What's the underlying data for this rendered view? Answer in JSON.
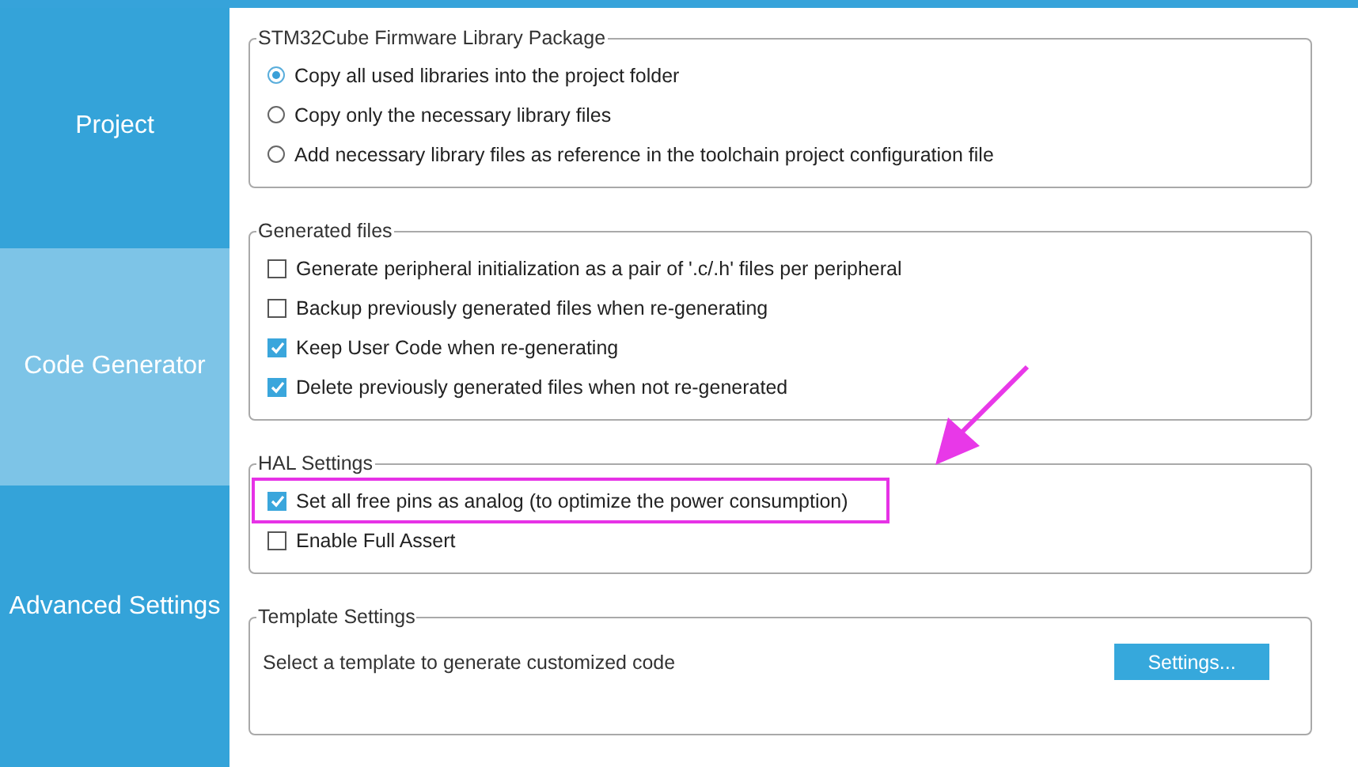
{
  "sidebar": {
    "items": [
      {
        "label": "Project",
        "selected": false
      },
      {
        "label": "Code Generator",
        "selected": true
      },
      {
        "label": "Advanced Settings",
        "selected": false
      }
    ]
  },
  "groups": [
    {
      "title": "STM32Cube Firmware Library Package",
      "options": [
        {
          "kind": "radio",
          "label": "Copy all used libraries into the project folder",
          "checked": true,
          "highlighted": false
        },
        {
          "kind": "radio",
          "label": "Copy only the necessary library files",
          "checked": false,
          "highlighted": false
        },
        {
          "kind": "radio",
          "label": "Add necessary library files as reference in the toolchain project configuration file",
          "checked": false,
          "highlighted": false
        }
      ]
    },
    {
      "title": "Generated files",
      "options": [
        {
          "kind": "checkbox",
          "label": "Generate peripheral initialization as a pair of '.c/.h' files per peripheral",
          "checked": false,
          "highlighted": false
        },
        {
          "kind": "checkbox",
          "label": "Backup previously generated files when re-generating",
          "checked": false,
          "highlighted": false
        },
        {
          "kind": "checkbox",
          "label": "Keep User Code when re-generating",
          "checked": true,
          "highlighted": false
        },
        {
          "kind": "checkbox",
          "label": "Delete previously generated files when not re-generated",
          "checked": true,
          "highlighted": false
        }
      ]
    },
    {
      "title": "HAL Settings",
      "options": [
        {
          "kind": "checkbox",
          "label": "Set all free pins as analog (to optimize the power consumption)",
          "checked": true,
          "highlighted": true
        },
        {
          "kind": "checkbox",
          "label": "Enable Full Assert",
          "checked": false,
          "highlighted": false
        }
      ]
    },
    {
      "title": "Template Settings",
      "description": "Select a template to generate customized code",
      "button": "Settings..."
    }
  ]
}
